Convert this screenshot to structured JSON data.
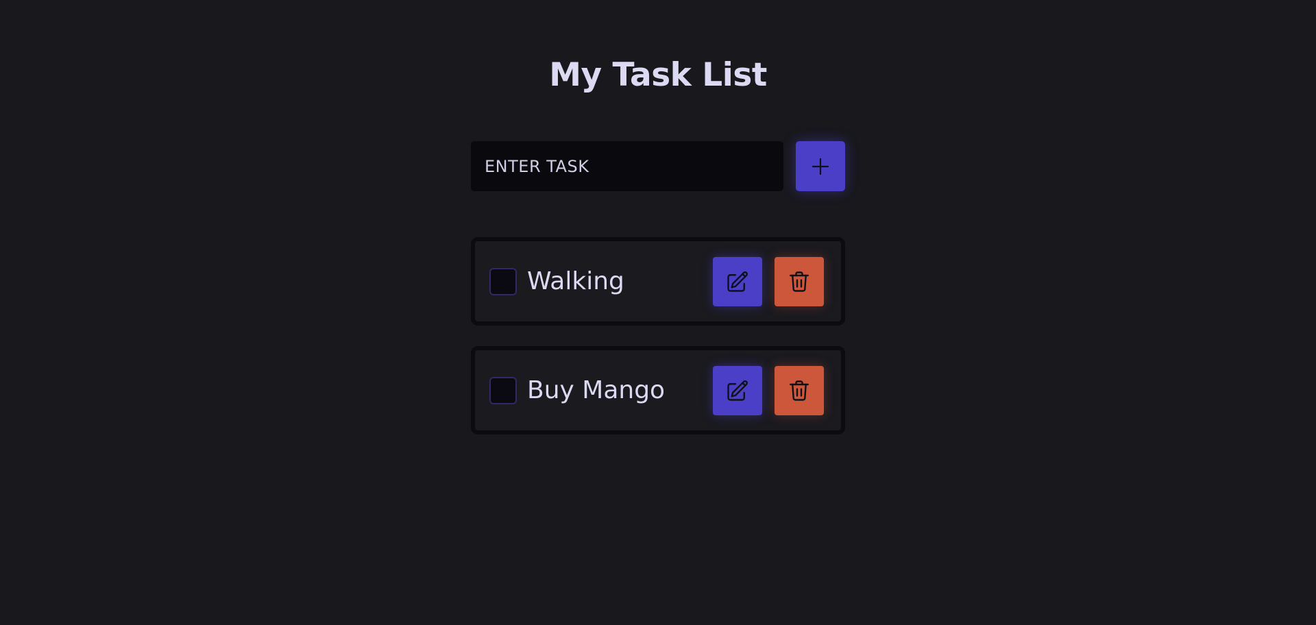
{
  "header": {
    "title": "My Task List"
  },
  "new_task": {
    "placeholder": "ENTER TASK",
    "value": "",
    "add_icon": "plus-icon"
  },
  "tasks": [
    {
      "label": "Walking",
      "done": false,
      "edit_icon": "pencil-square-icon",
      "delete_icon": "trash-icon"
    },
    {
      "label": "Buy Mango",
      "done": false,
      "edit_icon": "pencil-square-icon",
      "delete_icon": "trash-icon"
    }
  ],
  "colors": {
    "background": "#18181d",
    "primary": "#4b3fc8",
    "danger": "#cd573b",
    "text": "#dcd9f2"
  }
}
